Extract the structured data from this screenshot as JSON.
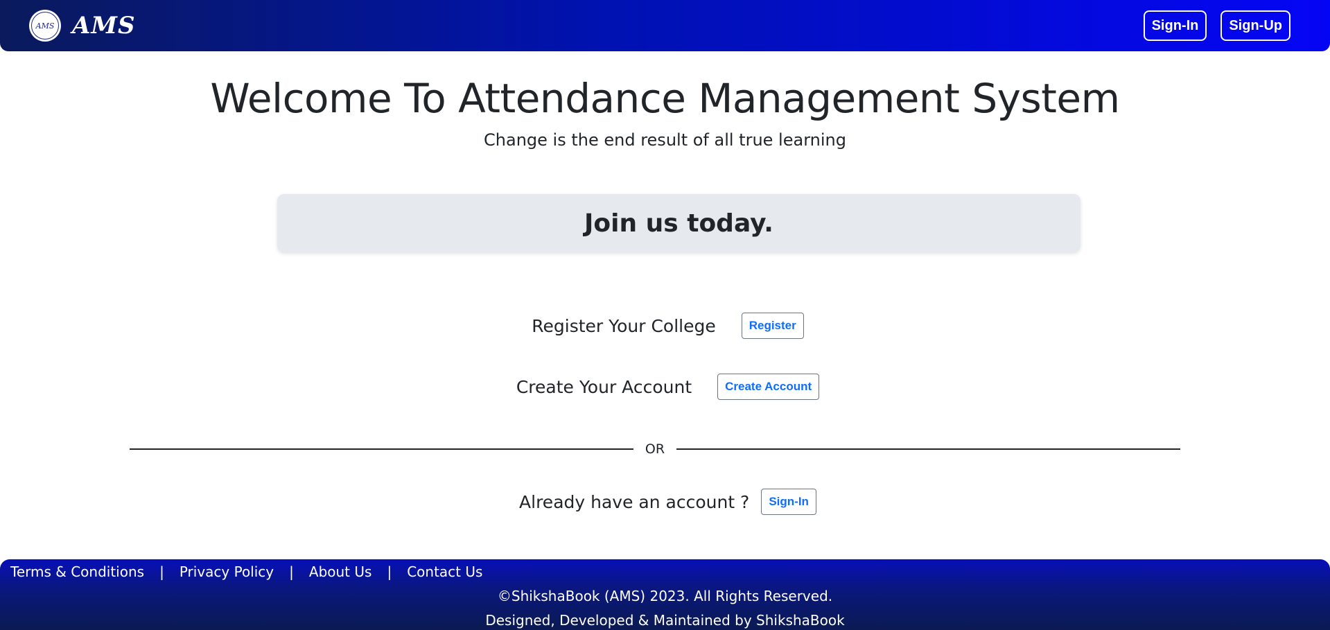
{
  "header": {
    "logo_text": "AMS",
    "brand_name": "AMS",
    "signin_label": "Sign-In",
    "signup_label": "Sign-Up"
  },
  "hero": {
    "title": "Welcome To Attendance Management System",
    "subtitle": "Change is the end result of all true learning"
  },
  "join_banner": {
    "text": "Join us today."
  },
  "actions": {
    "register_college_label": "Register Your College",
    "register_button": "Register",
    "create_account_label": "Create Your Account",
    "create_account_button": "Create Account",
    "or_text": "OR",
    "already_account_label": "Already have an account ?",
    "signin_button": "Sign-In"
  },
  "footer": {
    "links": [
      "Terms & Conditions",
      "Privacy Policy",
      "About Us",
      "Contact Us"
    ],
    "separator": "|",
    "copyright": "©ShikshaBook (AMS) 2023. All Rights Reserved.",
    "credit": "Designed, Developed & Maintained by ShikshaBook"
  },
  "colors": {
    "header_gradient_start": "#0a1a5c",
    "header_gradient_end": "#0505f5",
    "link_button_text": "#0d6efd",
    "banner_bg": "#e6e9ee"
  }
}
